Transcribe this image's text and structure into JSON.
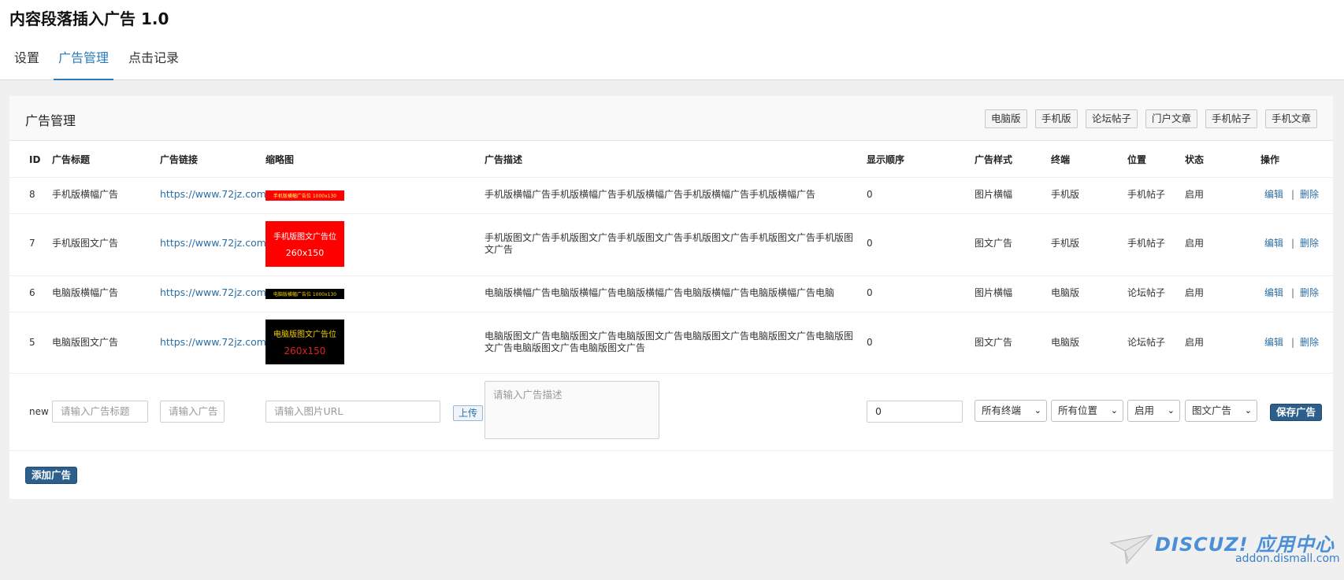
{
  "app": {
    "title": "内容段落插入广告 1.0"
  },
  "tabs": [
    {
      "label": "设置",
      "active": false
    },
    {
      "label": "广告管理",
      "active": true
    },
    {
      "label": "点击记录",
      "active": false
    }
  ],
  "panel": {
    "title": "广告管理",
    "filters": [
      "电脑版",
      "手机版",
      "论坛帖子",
      "门户文章",
      "手机帖子",
      "手机文章"
    ]
  },
  "table": {
    "headers": {
      "id": "ID",
      "title": "广告标题",
      "link": "广告链接",
      "thumb": "缩略图",
      "desc": "广告描述",
      "order": "显示顺序",
      "style": "广告样式",
      "terminal": "终端",
      "position": "位置",
      "status": "状态",
      "action": "操作"
    },
    "rows": [
      {
        "id": "8",
        "title": "手机版横幅广告",
        "link": "https://www.72jz.com/",
        "thumb_text": "手机版横幅广告位  1000x130",
        "desc": "手机版横幅广告手机版横幅广告手机版横幅广告手机版横幅广告手机版横幅广告",
        "order": "0",
        "style": "图片横幅",
        "terminal": "手机版",
        "position": "手机帖子",
        "status": "启用",
        "edit": "编辑",
        "sep": "|",
        "delete": "删除"
      },
      {
        "id": "7",
        "title": "手机版图文广告",
        "link": "https://www.72jz.com/",
        "thumb_text": "手机版图文广告位",
        "thumb_size": "260x150",
        "desc": "手机版图文广告手机版图文广告手机版图文广告手机版图文广告手机版图文广告手机版图文广告",
        "order": "0",
        "style": "图文广告",
        "terminal": "手机版",
        "position": "手机帖子",
        "status": "启用",
        "edit": "编辑",
        "sep": "|",
        "delete": "删除"
      },
      {
        "id": "6",
        "title": "电脑版横幅广告",
        "link": "https://www.72jz.com/",
        "thumb_text": "电脑版横幅广告位    1000x130",
        "desc": "电脑版横幅广告电脑版横幅广告电脑版横幅广告电脑版横幅广告电脑版横幅广告电脑",
        "order": "0",
        "style": "图片横幅",
        "terminal": "电脑版",
        "position": "论坛帖子",
        "status": "启用",
        "edit": "编辑",
        "sep": "|",
        "delete": "删除"
      },
      {
        "id": "5",
        "title": "电脑版图文广告",
        "link": "https://www.72jz.com/",
        "thumb_text": "电脑版图文广告位",
        "thumb_size": "260x150",
        "desc": "电脑版图文广告电脑版图文广告电脑版图文广告电脑版图文广告电脑版图文广告电脑版图文广告电脑版图文广告电脑版图文广告",
        "order": "0",
        "style": "图文广告",
        "terminal": "电脑版",
        "position": "论坛帖子",
        "status": "启用",
        "edit": "编辑",
        "sep": "|",
        "delete": "删除"
      }
    ],
    "new_row": {
      "id_label": "new",
      "title_placeholder": "请输入广告标题",
      "link_placeholder": "请输入广告",
      "image_placeholder": "请输入图片URL",
      "upload_label": "上传",
      "desc_placeholder": "请输入广告描述",
      "order_value": "0",
      "terminal_selected": "所有终端",
      "position_selected": "所有位置",
      "status_selected": "启用",
      "style_selected": "图文广告",
      "save_label": "保存广告"
    }
  },
  "add_button_label": "添加广告",
  "watermark": {
    "brand": "DISCUZ! 应用中心",
    "domain": "addon.dismall.com"
  },
  "colors": {
    "accent": "#2b7bb9",
    "link": "#2b6ea5",
    "primary_button": "#2d5f8d",
    "thumb_red": "#ff0000",
    "thumb_black": "#000000"
  }
}
